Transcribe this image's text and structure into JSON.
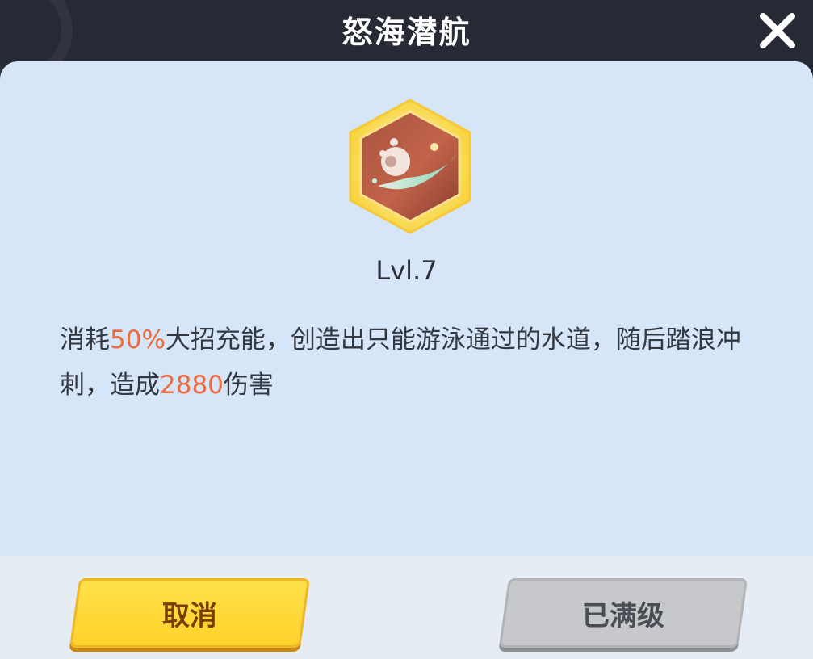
{
  "header": {
    "title": "怒海潜航"
  },
  "skill": {
    "level": "Lvl.7",
    "description": [
      {
        "text": "消耗",
        "highlight": false
      },
      {
        "text": "50%",
        "highlight": true
      },
      {
        "text": "大招充能，创造出只能游泳通过的水道，随后踏浪冲刺，造成",
        "highlight": false
      },
      {
        "text": "2880",
        "highlight": true
      },
      {
        "text": "伤害",
        "highlight": false
      }
    ],
    "icon": "skill-emblem-icon"
  },
  "buttons": {
    "cancel": "取消",
    "maxed": "已满级"
  },
  "colors": {
    "highlight": "#ef6a3c",
    "panel": "#d6e5f7",
    "header": "#262a35",
    "cancel_button": "#ffd22a",
    "maxed_button": "#c6c8cc"
  }
}
